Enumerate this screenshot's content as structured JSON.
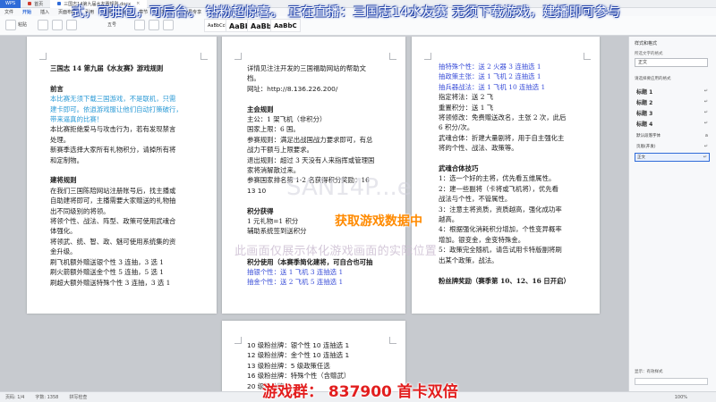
{
  "titlebar": {
    "app_label": "WPS",
    "tabs": [
      {
        "label": "首页",
        "active": false
      },
      {
        "label": "三国志14第九届水友赛规则.docx",
        "active": true
      }
    ]
  },
  "menu": [
    "文件",
    "开始",
    "插入",
    "页面布局",
    "引用",
    "审阅",
    "视图",
    "章节",
    "开发工具",
    "会员专享"
  ],
  "toolbar": {
    "paste_label": "粘贴",
    "font_size": "五号",
    "style_samples": [
      "AaBbCcDd",
      "AaBb",
      "AaBbI",
      "AaBbC"
    ]
  },
  "banner": "式，可抽包，可后台。  钻粉超惊喜。  正在直播：三国志14水友赛  无须下载游戏，建播即可参与",
  "page1": [
    {
      "t": "三国志 14 第九届《水友赛》游戏规则",
      "c": "h"
    },
    {
      "t": "",
      "c": "gap"
    },
    {
      "t": "前言",
      "c": "h"
    },
    {
      "t": "本比赛无须下载三国游戏，不是联机，只需",
      "c": "cyan"
    },
    {
      "t": "建卡即可。依逍游戏服让他们自动打策破行，",
      "c": "cyan"
    },
    {
      "t": "带来逼真的比赛！",
      "c": "cyan"
    },
    {
      "t": "本比赛拒绝爱马与攻击行为，若有发现禁言",
      "c": ""
    },
    {
      "t": "处理。",
      "c": ""
    },
    {
      "t": "新赛季选择大家所有礼物积分，请掉所有将",
      "c": ""
    },
    {
      "t": "和定制物。",
      "c": ""
    },
    {
      "t": "",
      "c": "gap"
    },
    {
      "t": "建将规则",
      "c": "h"
    },
    {
      "t": "在我们三国陈陪网站注册账号后，找主播或",
      "c": ""
    },
    {
      "t": "自助建将即可，主播需要大家赠送的礼物抽",
      "c": ""
    },
    {
      "t": "出不同级别的将领。",
      "c": ""
    },
    {
      "t": "将领个性、战法、阵型、政策可使用武魂合",
      "c": ""
    },
    {
      "t": "体强化。",
      "c": ""
    },
    {
      "t": "将领武、统、智、政、魅可使用系统集的资",
      "c": ""
    },
    {
      "t": "金升级。",
      "c": ""
    },
    {
      "t": "刷飞机额外赠送银个性 3 连抽，3 选 1",
      "c": ""
    },
    {
      "t": "刷火箭额外赠送金个性 5 连抽，5 选 1",
      "c": ""
    },
    {
      "t": "刷超大额外赠送特殊个性 3 连抽，3 选 1",
      "c": ""
    }
  ],
  "page2": [
    {
      "t": "详情见注注开发的三国福助网站的帮助文",
      "c": ""
    },
    {
      "t": "档。",
      "c": ""
    },
    {
      "t": "网址：http://8.136.226.200/",
      "c": "num"
    },
    {
      "t": "",
      "c": "gap"
    },
    {
      "t": "主会规则",
      "c": "h"
    },
    {
      "t": "主公：1 架飞机（非积分）",
      "c": ""
    },
    {
      "t": "国家上限：6 国。",
      "c": ""
    },
    {
      "t": "参赛规则：满足出战国战力要求即可，有总",
      "c": ""
    },
    {
      "t": "战力干额与上限要求。",
      "c": ""
    },
    {
      "t": "退出规则：超过 3 天没有人来指挥或管理国",
      "c": ""
    },
    {
      "t": "家将消解散过来。",
      "c": ""
    },
    {
      "t": "参赛国家排名第 1-2 名获得积分奖励：16",
      "c": ""
    },
    {
      "t": "13  10",
      "c": "num"
    },
    {
      "t": "",
      "c": "gap"
    },
    {
      "t": "积分获得",
      "c": "h"
    },
    {
      "t": "1 元礼物=1 积分",
      "c": ""
    },
    {
      "t": "辅助系统签到送积分",
      "c": ""
    },
    {
      "t": "",
      "c": "gap"
    },
    {
      "t": "",
      "c": "gap"
    },
    {
      "t": "积分使用（本赛季简化建将，可自合也可抽",
      "c": "h"
    },
    {
      "t": "抽银个性：送 1 飞机 3 连抽选 1",
      "c": "blue"
    },
    {
      "t": "抽金个性：送 2 飞机 5 连抽选 1",
      "c": "blue"
    }
  ],
  "page3": [
    {
      "t": "抽特殊个性：送 2 火器 3 连抽选 1",
      "c": "blue"
    },
    {
      "t": "抽政策主张：送 1 飞机 2 连抽选 1",
      "c": "blue"
    },
    {
      "t": "抽兵器战法：送 1 飞机 10 连抽选 1",
      "c": "blue"
    },
    {
      "t": "指定将法：送 2 飞",
      "c": ""
    },
    {
      "t": "重置积分：送 1 飞",
      "c": ""
    },
    {
      "t": "将领修改：免费赠送改名，主张 2 次，此后",
      "c": ""
    },
    {
      "t": "6 积分/次。",
      "c": ""
    },
    {
      "t": "武魂合体：折建大量剧将，用于自主强化主",
      "c": ""
    },
    {
      "t": "将的个性、战法、政策等。",
      "c": ""
    },
    {
      "t": "",
      "c": "gap"
    },
    {
      "t": "武魂合体技巧",
      "c": "h"
    },
    {
      "t": "1：选一个好的主将，优先看五维属性。",
      "c": ""
    },
    {
      "t": "2：建一些副将（卡将或飞机将），优先看",
      "c": ""
    },
    {
      "t": "战法与个性，不管属性。",
      "c": ""
    },
    {
      "t": "3：注意主将资质，资质越高，强化成功率",
      "c": ""
    },
    {
      "t": "越高。",
      "c": ""
    },
    {
      "t": "4：根据强化消耗积分增加，个性变异概率",
      "c": ""
    },
    {
      "t": "增加。银变金，金变特殊金。",
      "c": ""
    },
    {
      "t": "5：政策完全随机，请告试用卡特版副将刷",
      "c": ""
    },
    {
      "t": "出某个政策，战法。",
      "c": ""
    },
    {
      "t": "",
      "c": "gap"
    },
    {
      "t": "粉丝牌奖励（赛季第 10、12、16 日开启）",
      "c": "h"
    }
  ],
  "page4": [
    {
      "t": "10 级粉丝牌：银个性 10 连抽选 1",
      "c": ""
    },
    {
      "t": "12 级粉丝牌：金个性 10 连抽选 1",
      "c": ""
    },
    {
      "t": "13 级粉丝牌：5 级政策任选",
      "c": ""
    },
    {
      "t": "16 级粉丝牌：特殊个性（含赠武）",
      "c": ""
    },
    {
      "t": "20 级粉丝牌",
      "c": ""
    }
  ],
  "overlays": {
    "loading": "获取游戏数据中",
    "watermark": "此画面仅展示体化游戏画面的实际位置",
    "big_watermark": "SAN14P...e",
    "group": "游戏群： 837900  首卡双倍"
  },
  "pane": {
    "title": "样式和格式",
    "sub": "所选文字的格式",
    "current": "正文",
    "heading": "请选择要应用的格式",
    "styles": [
      {
        "name": "标题 1",
        "mark": "↵",
        "selected": false
      },
      {
        "name": "标题 2",
        "mark": "↵",
        "selected": false
      },
      {
        "name": "标题 3",
        "mark": "↵",
        "selected": false
      },
      {
        "name": "标题 4",
        "mark": "↵",
        "selected": false
      },
      {
        "name": "默认段落字体",
        "mark": "a",
        "selected": false,
        "small": true
      },
      {
        "name": "页眉(开发)",
        "mark": "↵",
        "selected": false,
        "small": true
      },
      {
        "name": "正文",
        "mark": "↵",
        "selected": true,
        "small": true
      }
    ],
    "bottom_label": "显示：有效样式"
  },
  "status": {
    "page": "页码: 1/4",
    "words": "字数: 1358",
    "spell": "拼写检查",
    "zoom": "100%"
  }
}
